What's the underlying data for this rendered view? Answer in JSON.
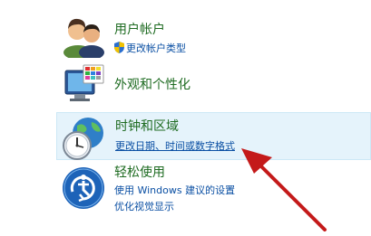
{
  "categories": [
    {
      "title": "用户帐户",
      "icon": "users-icon",
      "links": [
        "更改帐户类型"
      ],
      "link_icon": "uac-shield-icon"
    },
    {
      "title": "外观和个性化",
      "icon": "appearance-monitor-icon",
      "links": []
    },
    {
      "title": "时钟和区域",
      "icon": "clock-globe-icon",
      "links": [
        "更改日期、时间或数字格式"
      ],
      "highlighted": true
    },
    {
      "title": "轻松使用",
      "icon": "ease-of-access-icon",
      "links": [
        "使用 Windows 建议的设置",
        "优化视觉显示"
      ]
    }
  ],
  "annotation": {
    "type": "red-arrow",
    "color": "#c41a1a",
    "points_to": "更改日期、时间或数字格式"
  },
  "colors": {
    "title": "#1e6b21",
    "link": "#0a4fa3",
    "hover_bg": "#e5f3fb"
  }
}
